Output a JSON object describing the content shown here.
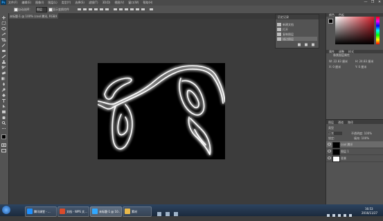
{
  "app": {
    "logo": "Ps",
    "menu": [
      "文件(F)",
      "编辑(E)",
      "图像(I)",
      "图层(L)",
      "类型(Y)",
      "选择(S)",
      "滤镜(T)",
      "3D(D)",
      "视图(V)",
      "窗口(W)",
      "帮助(H)"
    ],
    "window_controls": [
      "—",
      "❐",
      "✕"
    ]
  },
  "options_bar": {
    "auto_select": "自动选择：",
    "layer": "图层",
    "show_transform": "显示变换控件"
  },
  "document_tab": {
    "title": "未标题-1 @ 100% (cool 腾讯, RGB/8) *"
  },
  "status_bar": {
    "zoom": "100%",
    "doc_size": "文档:448.7K/1.17M"
  },
  "history_panel": {
    "tab": "历史记录",
    "items": [
      "新建文档",
      "打开",
      "复制图层",
      "描边图层"
    ]
  },
  "color_panel": {
    "tabs": [
      "颜色",
      "色板"
    ],
    "accent": "#d21f2a"
  },
  "properties_panel": {
    "tabs": [
      "属性",
      "调整",
      "样式"
    ],
    "title": "像素图层属性",
    "w_label": "W: 22.83 厘米",
    "h_label": "H: 24.83 厘米",
    "x_label": "X: 0 厘米",
    "y_label": "Y: 0 厘米"
  },
  "layers_panel": {
    "tabs": [
      "图层",
      "通道",
      "路径"
    ],
    "kind_label": "类型",
    "blend_mode": "正常",
    "opacity_label": "不透明度: 100%",
    "lock_label": "锁定:",
    "fill_label": "填充: 100%",
    "layers": [
      {
        "name": "cool 腾讯",
        "thumb": "#000000",
        "selected": true
      },
      {
        "name": "图层 1",
        "thumb": "#000000",
        "selected": false
      },
      {
        "name": "背景",
        "thumb": "#ffffff",
        "selected": false
      }
    ]
  },
  "taskbar": {
    "tasks": [
      {
        "label": "腾讯课堂 - ...",
        "color": "#1e90ff"
      },
      {
        "label": "文档 - WPS 文...",
        "color": "#d94b2b"
      },
      {
        "label": "未标题-1 @ 10...",
        "color": "#31a8ff"
      },
      {
        "label": "素材",
        "color": "#e8b84a"
      }
    ],
    "tray_time": "16:53",
    "tray_date": "2016/11/27"
  }
}
